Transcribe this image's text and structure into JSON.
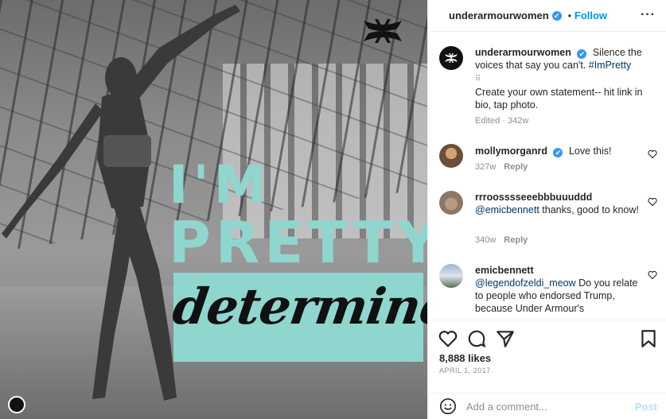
{
  "post": {
    "headline_line1": "I'M",
    "headline_line2": "PRETTY",
    "script_word": "determined",
    "accent_color": "#8fd6cf"
  },
  "header": {
    "username": "underarmourwomen",
    "verified_mark": "✔",
    "separator": "•",
    "follow_label": "Follow",
    "more_label": "···"
  },
  "caption": {
    "username": "underarmourwomen",
    "verified_mark": "✔",
    "text": "Silence the voices that say you can't.",
    "hashtag": "#ImPretty",
    "divider": "⠿",
    "text2": "Create your own statement-- hit link in bio, tap photo.",
    "meta": "Edited · 342w"
  },
  "comments": [
    {
      "username": "mollymorganrd",
      "verified_mark": "✔",
      "text": "Love this!",
      "age": "327w",
      "reply_label": "Reply"
    },
    {
      "username": "rrroosssseeebbbuuuddd",
      "mention": "@emicbennett",
      "text": "thanks, good to know!",
      "age": "340w",
      "reply_label": "Reply"
    },
    {
      "username": "emicbennett",
      "mention": "@legendofzeldi_meow",
      "text": "Do you relate to people who endorsed Trump, because Under Armour's"
    }
  ],
  "actions": {
    "likes": "8,888 likes",
    "date": "APRIL 1, 2017"
  },
  "comment_box": {
    "placeholder": "Add a comment...",
    "post_label": "Post"
  }
}
